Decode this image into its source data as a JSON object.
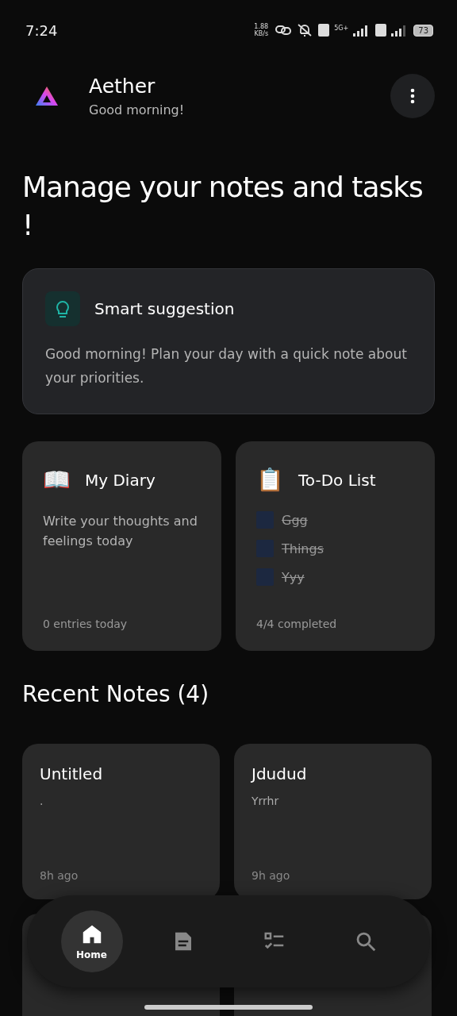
{
  "status_bar": {
    "time": "7:24",
    "net_speed": "1.88 KB/s",
    "network": "5G+",
    "battery": "73"
  },
  "header": {
    "app_name": "Aether",
    "greeting": "Good morning!"
  },
  "headline": "Manage your notes and tasks !",
  "suggestion": {
    "title": "Smart suggestion",
    "text": "Good morning! Plan your day with a quick note about your priorities."
  },
  "diary": {
    "icon": "📖",
    "title": "My Diary",
    "text": "Write your thoughts and feelings today",
    "footer": "0 entries today"
  },
  "todo": {
    "icon": "📋",
    "title": "To-Do List",
    "items": [
      {
        "label": "Ggg",
        "checked": true
      },
      {
        "label": "Things",
        "checked": true
      },
      {
        "label": "Yyy",
        "checked": true
      }
    ],
    "footer": "4/4 completed"
  },
  "recent_notes": {
    "title": "Recent Notes (4)",
    "notes": [
      {
        "title": "Untitled",
        "preview": ".",
        "time": "8h ago"
      },
      {
        "title": "Jdudud",
        "preview": "Yrrhr",
        "time": "9h ago"
      }
    ]
  },
  "nav": [
    {
      "kind": "home",
      "label": "Home",
      "selected": true
    },
    {
      "kind": "notes",
      "selected": false
    },
    {
      "kind": "tasks",
      "selected": false
    },
    {
      "kind": "search",
      "selected": false
    }
  ]
}
